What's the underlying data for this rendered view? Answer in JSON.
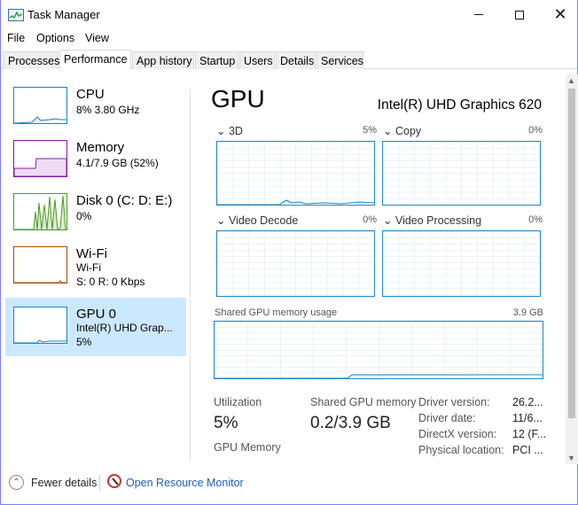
{
  "window": {
    "title": "Task Manager"
  },
  "menu": [
    "File",
    "Options",
    "View"
  ],
  "tabs": [
    "Processes",
    "Performance",
    "App history",
    "Startup",
    "Users",
    "Details",
    "Services"
  ],
  "sidebar": [
    {
      "name": "CPU",
      "sub1": "8% 3.80 GHz",
      "sub2": "",
      "sub3": "",
      "color": "#1784c7"
    },
    {
      "name": "Memory",
      "sub1": "4.1/7.9 GB (52%)",
      "sub2": "",
      "sub3": "",
      "color": "#8b18a8"
    },
    {
      "name": "Disk 0 (C: D: E:)",
      "sub1": "0%",
      "sub2": "",
      "sub3": "",
      "color": "#4a9a1a"
    },
    {
      "name": "Wi-Fi",
      "sub1": "Wi-Fi",
      "sub2": "S: 0 R: 0 Kbps",
      "sub3": "",
      "color": "#a84d00"
    },
    {
      "name": "GPU 0",
      "sub1": "Intel(R) UHD Grap...",
      "sub2": "5%",
      "sub3": "",
      "color": "#1784c7"
    }
  ],
  "gpu": {
    "title": "GPU",
    "model": "Intel(R) UHD Graphics 620",
    "engines": [
      {
        "label": "3D",
        "value": "5%"
      },
      {
        "label": "Copy",
        "value": "0%"
      },
      {
        "label": "Video Decode",
        "value": "0%"
      },
      {
        "label": "Video Processing",
        "value": "0%"
      }
    ],
    "shared_label": "Shared GPU memory usage",
    "shared_value": "3.9 GB",
    "utilization_label": "Utilization",
    "utilization_value": "5%",
    "shared_mem_label": "Shared GPU memory",
    "shared_mem_value": "0.2/3.9 GB",
    "gpu_memory_label": "GPU Memory",
    "driver_version_label": "Driver version:",
    "driver_version_value": "26.2...",
    "driver_date_label": "Driver date:",
    "driver_date_value": "11/6...",
    "directx_label": "DirectX version:",
    "directx_value": "12 (F...",
    "physical_label": "Physical location:",
    "physical_value": "PCI ..."
  },
  "footer": {
    "fewer": "Fewer details",
    "monitor": "Open Resource Monitor"
  }
}
